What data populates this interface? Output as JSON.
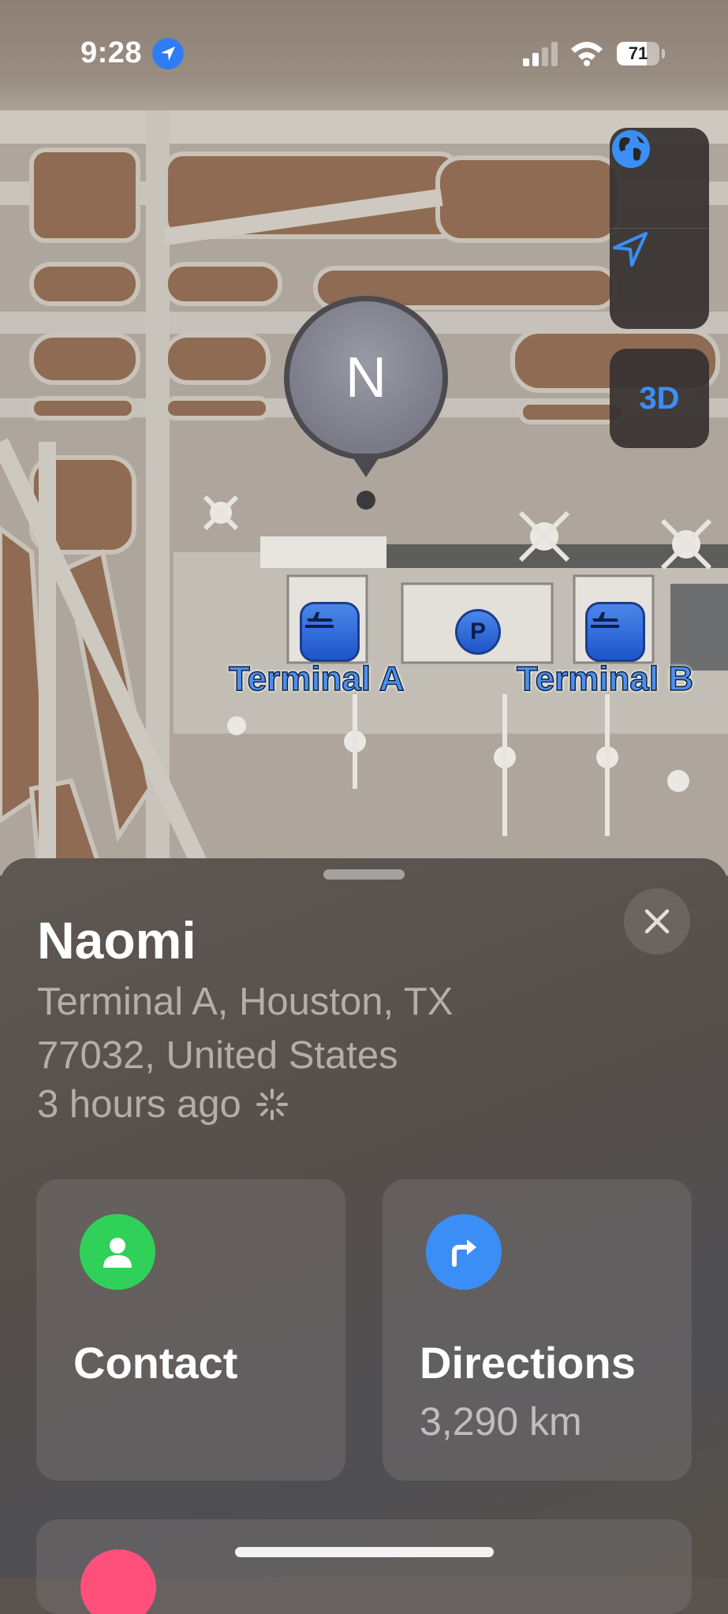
{
  "status_bar": {
    "time": "9:28",
    "battery": "71",
    "battery_level": 0.71
  },
  "map": {
    "controls": {
      "globe_icon": "globe-icon",
      "location_icon": "location-arrow-icon",
      "three_d_label": "3D"
    },
    "pin_initial": "N",
    "terminals": [
      {
        "label": "Terminal A"
      },
      {
        "label": "Terminal B"
      }
    ],
    "parking_label": "P"
  },
  "sheet": {
    "name": "Naomi",
    "address_line1": "Terminal A, Houston, TX",
    "address_line2": "77032, United States",
    "last_seen": "3 hours ago",
    "actions": [
      {
        "title": "Contact",
        "subtitle": "",
        "icon": "person-icon",
        "color": "#30d158"
      },
      {
        "title": "Directions",
        "subtitle": "3,290 km",
        "icon": "turn-right-arrow-icon",
        "color": "#3b8ef5"
      }
    ]
  },
  "colors": {
    "accent_blue": "#3b8ef5",
    "contact_green": "#30d158",
    "pink": "#ff4f7b"
  }
}
